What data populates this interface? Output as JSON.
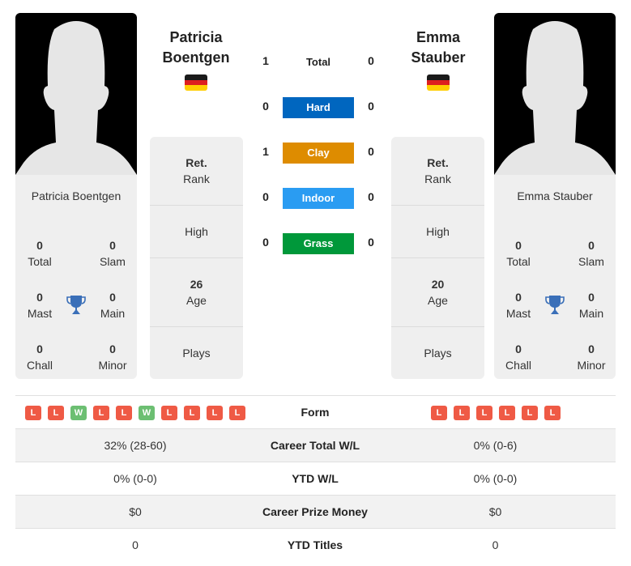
{
  "players": [
    {
      "name": "Patricia Boentgen",
      "name_line1": "Patricia",
      "name_line2": "Boentgen",
      "country_flag": "germany-flag",
      "titles": {
        "total": {
          "value": "0",
          "label": "Total"
        },
        "slam": {
          "value": "0",
          "label": "Slam"
        },
        "mast": {
          "value": "0",
          "label": "Mast"
        },
        "main": {
          "value": "0",
          "label": "Main"
        },
        "chall": {
          "value": "0",
          "label": "Chall"
        },
        "minor": {
          "value": "0",
          "label": "Minor"
        }
      },
      "info": {
        "rank_value": "Ret.",
        "rank_label": "Rank",
        "high_label": "High",
        "age_value": "26",
        "age_label": "Age",
        "plays_label": "Plays"
      },
      "form": [
        "L",
        "L",
        "W",
        "L",
        "L",
        "W",
        "L",
        "L",
        "L",
        "L"
      ],
      "career_total_wl": "32% (28-60)",
      "ytd_wl": "0% (0-0)",
      "career_prize_money": "$0",
      "ytd_titles": "0"
    },
    {
      "name": "Emma Stauber",
      "name_line1": "Emma",
      "name_line2": "Stauber",
      "country_flag": "germany-flag",
      "titles": {
        "total": {
          "value": "0",
          "label": "Total"
        },
        "slam": {
          "value": "0",
          "label": "Slam"
        },
        "mast": {
          "value": "0",
          "label": "Mast"
        },
        "main": {
          "value": "0",
          "label": "Main"
        },
        "chall": {
          "value": "0",
          "label": "Chall"
        },
        "minor": {
          "value": "0",
          "label": "Minor"
        }
      },
      "info": {
        "rank_value": "Ret.",
        "rank_label": "Rank",
        "high_label": "High",
        "age_value": "20",
        "age_label": "Age",
        "plays_label": "Plays"
      },
      "form": [
        "L",
        "L",
        "L",
        "L",
        "L",
        "L"
      ],
      "career_total_wl": "0% (0-6)",
      "ytd_wl": "0% (0-0)",
      "career_prize_money": "$0",
      "ytd_titles": "0"
    }
  ],
  "h2h": [
    {
      "label": "Total",
      "left": "1",
      "right": "0",
      "color": ""
    },
    {
      "label": "Hard",
      "left": "0",
      "right": "0",
      "color": "#0066bf"
    },
    {
      "label": "Clay",
      "left": "1",
      "right": "0",
      "color": "#de8c00"
    },
    {
      "label": "Indoor",
      "left": "0",
      "right": "0",
      "color": "#2a9cf2"
    },
    {
      "label": "Grass",
      "left": "0",
      "right": "0",
      "color": "#00983a"
    }
  ],
  "comparison_labels": {
    "form": "Form",
    "career_total_wl": "Career Total W/L",
    "ytd_wl": "YTD W/L",
    "career_prize_money": "Career Prize Money",
    "ytd_titles": "YTD Titles"
  },
  "colors": {
    "loss": "#ef5a45",
    "win": "#6cbf72",
    "trophy": "#3a6fb8",
    "flag_black": "#1a1a1a",
    "flag_red": "#dd1f1f",
    "flag_gold": "#ffce00"
  }
}
